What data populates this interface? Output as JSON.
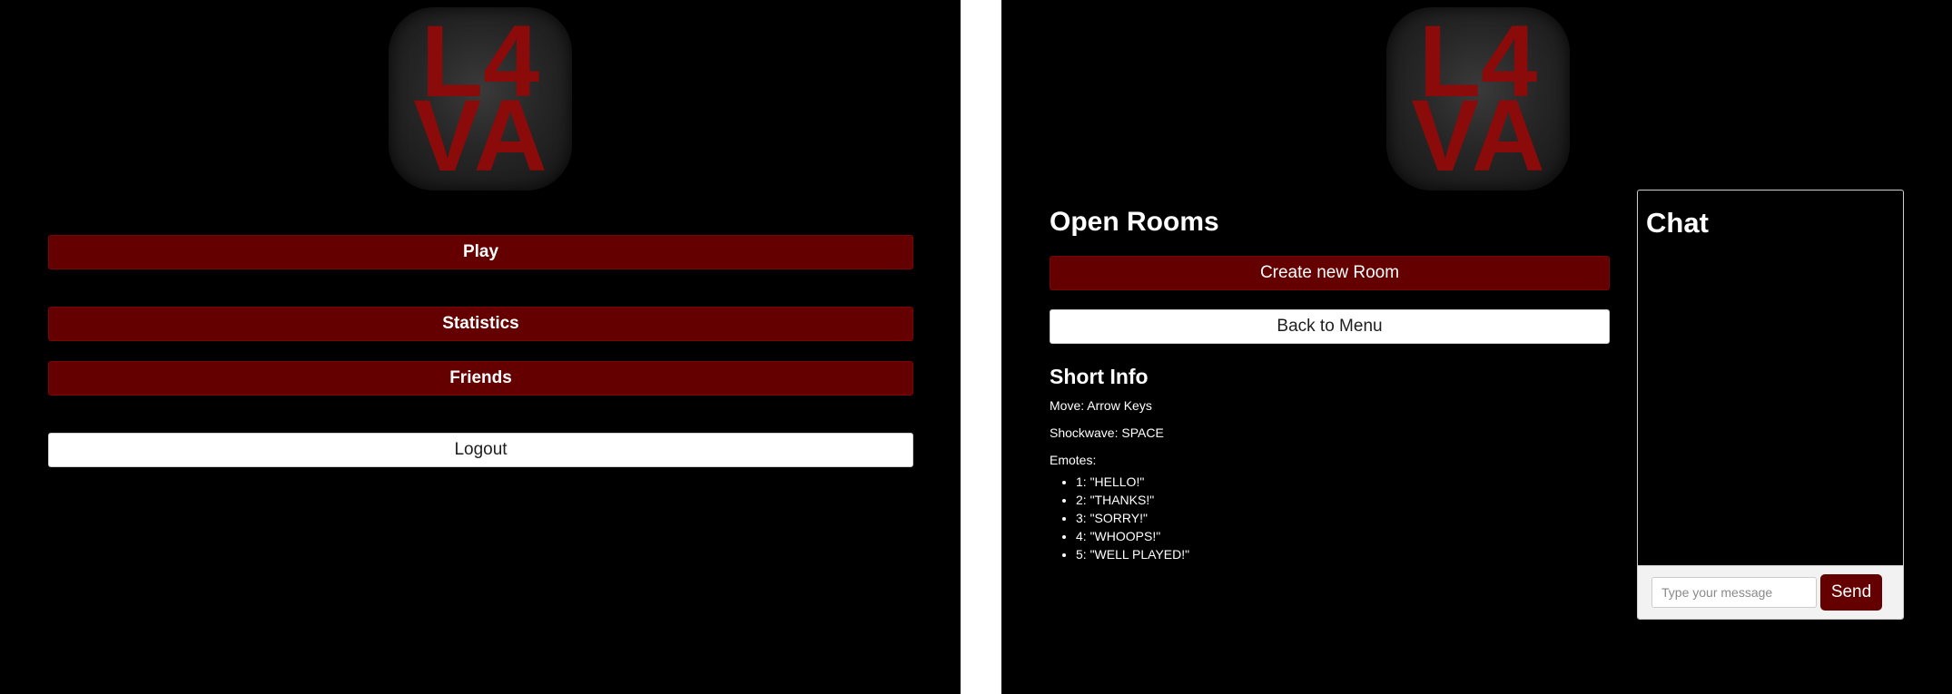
{
  "brand": {
    "logo_text_top": "L4",
    "logo_text_bottom": "VA",
    "logo_color": "#8b0a0a"
  },
  "colors": {
    "accent": "#640000",
    "background": "#000000",
    "secondary_button": "#ffffff"
  },
  "menu": {
    "play_label": "Play",
    "statistics_label": "Statistics",
    "friends_label": "Friends",
    "logout_label": "Logout"
  },
  "lobby": {
    "title": "Open Rooms",
    "create_room_label": "Create new Room",
    "back_label": "Back to Menu",
    "info": {
      "title": "Short Info",
      "move": "Move: Arrow Keys",
      "shockwave": "Shockwave: SPACE",
      "emotes_label": "Emotes:",
      "emotes": [
        "1: \"HELLO!\"",
        "2: \"THANKS!\"",
        "3: \"SORRY!\"",
        "4: \"WHOOPS!\"",
        "5: \"WELL PLAYED!\""
      ]
    }
  },
  "chat": {
    "title": "Chat",
    "input_value": "",
    "input_placeholder": "Type your message",
    "send_label": "Send"
  }
}
